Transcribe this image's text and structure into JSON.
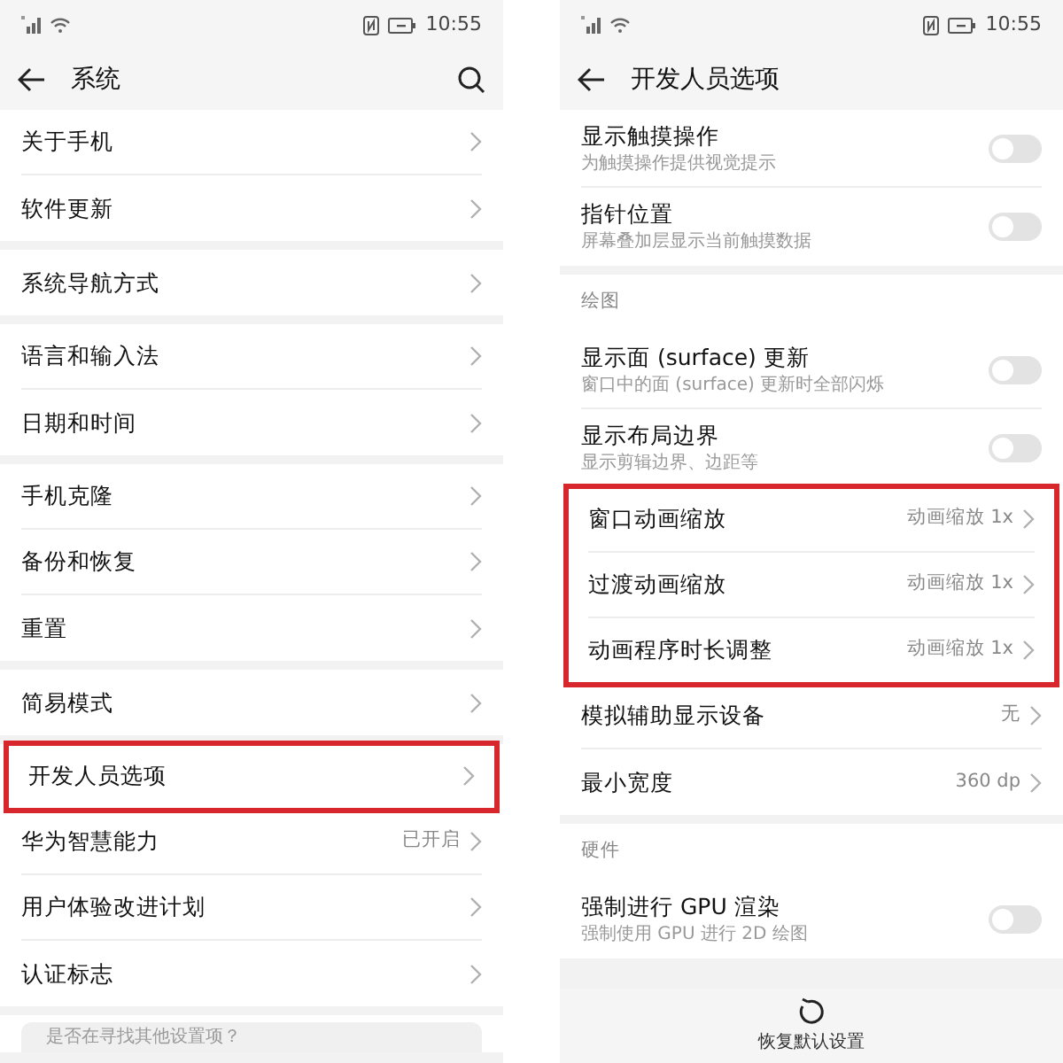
{
  "screens": [
    {
      "status_bar": {
        "time": "10:55"
      },
      "title": "系统",
      "has_search": true,
      "groups": [
        {
          "items": [
            {
              "kind": "link",
              "label": "关于手机",
              "highlighted": false
            },
            {
              "kind": "link",
              "label": "软件更新",
              "highlighted": false
            }
          ]
        },
        {
          "items": [
            {
              "kind": "link",
              "label": "系统导航方式",
              "highlighted": false
            }
          ]
        },
        {
          "items": [
            {
              "kind": "link",
              "label": "语言和输入法",
              "highlighted": false
            },
            {
              "kind": "link",
              "label": "日期和时间",
              "highlighted": false
            }
          ]
        },
        {
          "items": [
            {
              "kind": "link",
              "label": "手机克隆",
              "highlighted": false
            },
            {
              "kind": "link",
              "label": "备份和恢复",
              "highlighted": false
            },
            {
              "kind": "link",
              "label": "重置",
              "highlighted": false
            }
          ]
        },
        {
          "items": [
            {
              "kind": "link",
              "label": "简易模式",
              "highlighted": false
            }
          ]
        },
        {
          "items": [
            {
              "kind": "link",
              "label": "开发人员选项",
              "highlighted": true
            },
            {
              "kind": "link",
              "label": "华为智慧能力",
              "value": "已开启",
              "highlighted": false
            },
            {
              "kind": "link",
              "label": "用户体验改进计划",
              "highlighted": false
            },
            {
              "kind": "link",
              "label": "认证标志",
              "highlighted": false
            }
          ]
        }
      ],
      "hint_card": "是否在寻找其他设置项？"
    },
    {
      "status_bar": {
        "time": "10:55"
      },
      "title": "开发人员选项",
      "has_search": false,
      "groups": [
        {
          "items": [
            {
              "kind": "switch",
              "label": "显示触摸操作",
              "subtitle": "为触摸操作提供视觉提示",
              "on": false,
              "highlighted": false
            },
            {
              "kind": "switch",
              "label": "指针位置",
              "subtitle": "屏幕叠加层显示当前触摸数据",
              "on": false,
              "highlighted": false
            }
          ]
        },
        {
          "header": "绘图",
          "items": [
            {
              "kind": "switch",
              "label": "显示面 (surface) 更新",
              "subtitle": "窗口中的面 (surface) 更新时全部闪烁",
              "on": false,
              "highlighted": false
            },
            {
              "kind": "switch",
              "label": "显示布局边界",
              "subtitle": "显示剪辑边界、边距等",
              "on": false,
              "highlighted": false
            },
            {
              "kind": "link",
              "label": "窗口动画缩放",
              "value": "动画缩放 1x",
              "highlighted": true
            },
            {
              "kind": "link",
              "label": "过渡动画缩放",
              "value": "动画缩放 1x",
              "highlighted": true
            },
            {
              "kind": "link",
              "label": "动画程序时长调整",
              "value": "动画缩放 1x",
              "highlighted": true
            },
            {
              "kind": "link",
              "label": "模拟辅助显示设备",
              "value": "无",
              "highlighted": false
            },
            {
              "kind": "link",
              "label": "最小宽度",
              "value": "360 dp",
              "highlighted": false
            }
          ]
        },
        {
          "header": "硬件",
          "items": [
            {
              "kind": "switch",
              "label": "强制进行 GPU 渲染",
              "subtitle": "强制使用 GPU 进行 2D 绘图",
              "on": false,
              "highlighted": false
            }
          ]
        }
      ],
      "bottom_action": "恢复默认设置"
    }
  ]
}
